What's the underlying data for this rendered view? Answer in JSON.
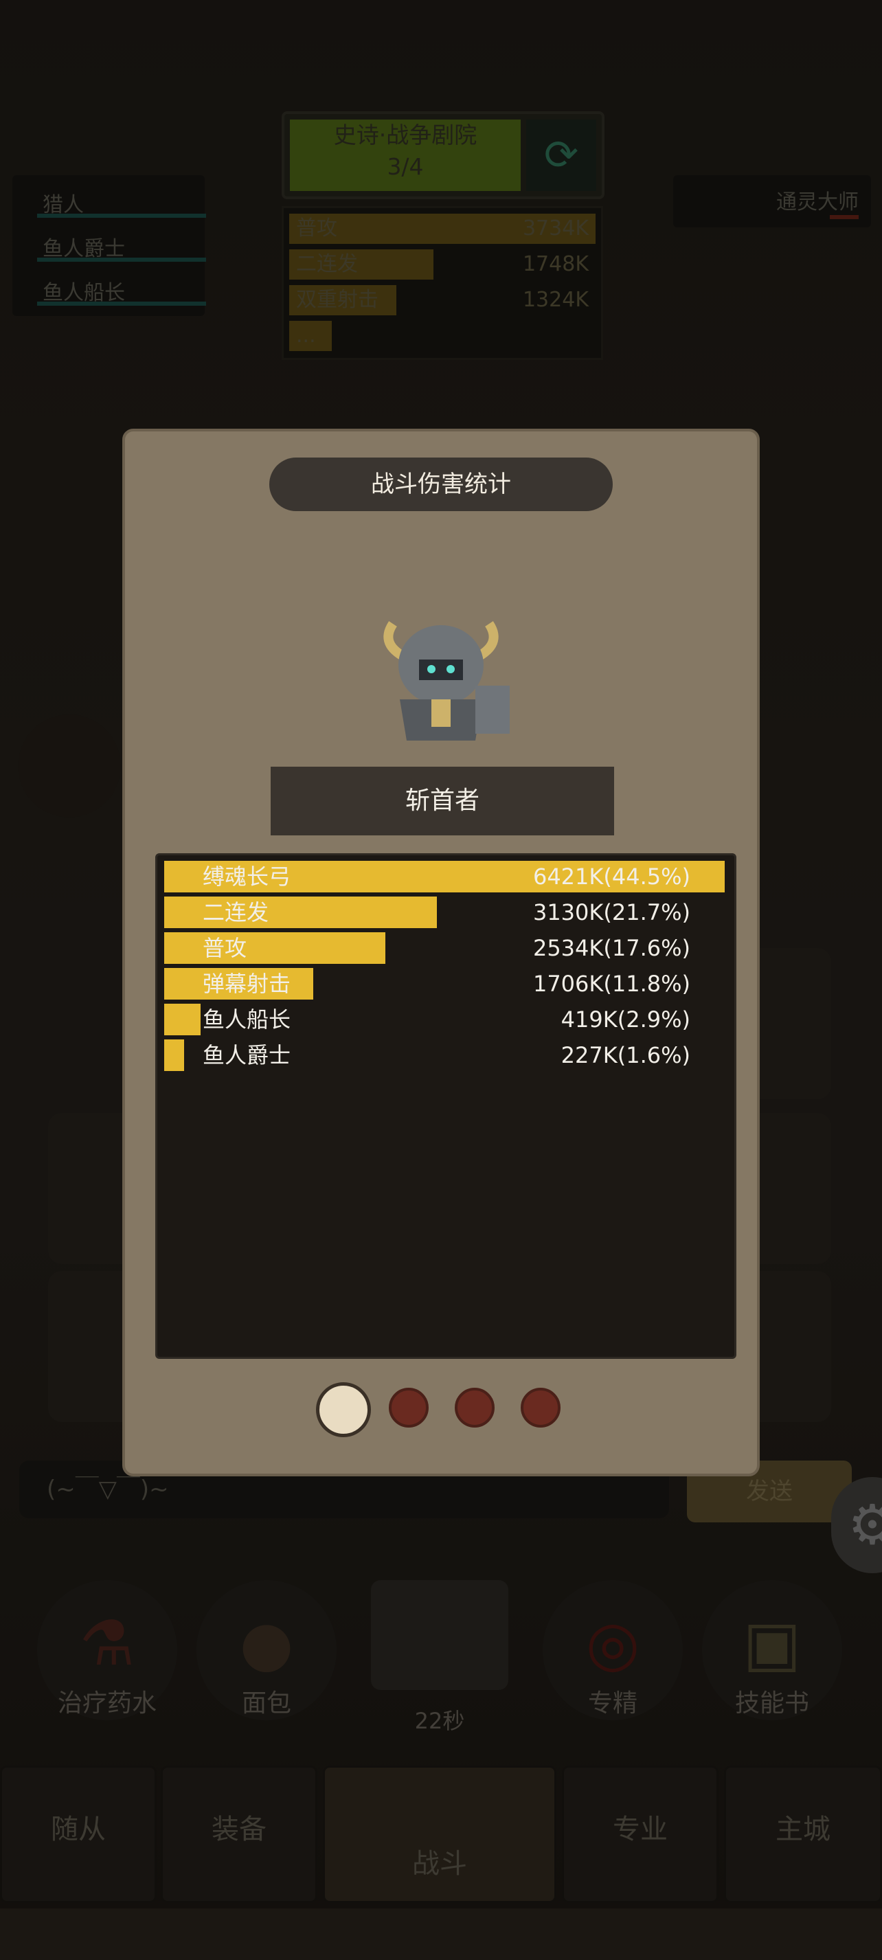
{
  "dungeon": {
    "title": "史诗·战争剧院",
    "progress": "3/4"
  },
  "skills_mini": [
    {
      "label": "普攻",
      "value": "3734K",
      "fill": 1.0
    },
    {
      "label": "二连发",
      "value": "1748K",
      "fill": 0.47
    },
    {
      "label": "双重射击",
      "value": "1324K",
      "fill": 0.35
    },
    {
      "label": "...",
      "value": "",
      "fill": 0.14
    }
  ],
  "party": [
    {
      "name": "猎人"
    },
    {
      "name": "鱼人爵士"
    },
    {
      "name": "鱼人船长"
    }
  ],
  "enemy": {
    "name": "通灵大师"
  },
  "modal": {
    "title": "战斗伤害统计",
    "character": "斩首者",
    "rows": [
      {
        "label": "缚魂长弓",
        "value": "6421K(44.5%)",
        "fraction": 1.0
      },
      {
        "label": "二连发",
        "value": "3130K(21.7%)",
        "fraction": 0.487
      },
      {
        "label": "普攻",
        "value": "2534K(17.6%)",
        "fraction": 0.395
      },
      {
        "label": "弹幕射击",
        "value": "1706K(11.8%)",
        "fraction": 0.266
      },
      {
        "label": "鱼人船长",
        "value": "419K(2.9%)",
        "fraction": 0.065
      },
      {
        "label": "鱼人爵士",
        "value": "227K(1.6%)",
        "fraction": 0.035
      }
    ],
    "active_page": 1,
    "page_count": 4
  },
  "chat": {
    "placeholder": "(~￣▽￣)~",
    "send": "发送"
  },
  "consumables": [
    {
      "label": "治疗药水",
      "icon": "potion-icon"
    },
    {
      "label": "面包",
      "icon": "bread-icon"
    },
    {
      "label": "专精",
      "icon": "specialization-icon"
    },
    {
      "label": "技能书",
      "icon": "skillbook-icon"
    }
  ],
  "chest": {
    "timer": "22秒",
    "icon": "chest-icon"
  },
  "nav": [
    {
      "label": "随从"
    },
    {
      "label": "装备"
    },
    {
      "label": "战斗"
    },
    {
      "label": "专业"
    },
    {
      "label": "主城"
    }
  ],
  "colors": {
    "bar": "#e6ba30",
    "modal_bg": "#857864",
    "stats_bg": "#1c1814"
  }
}
